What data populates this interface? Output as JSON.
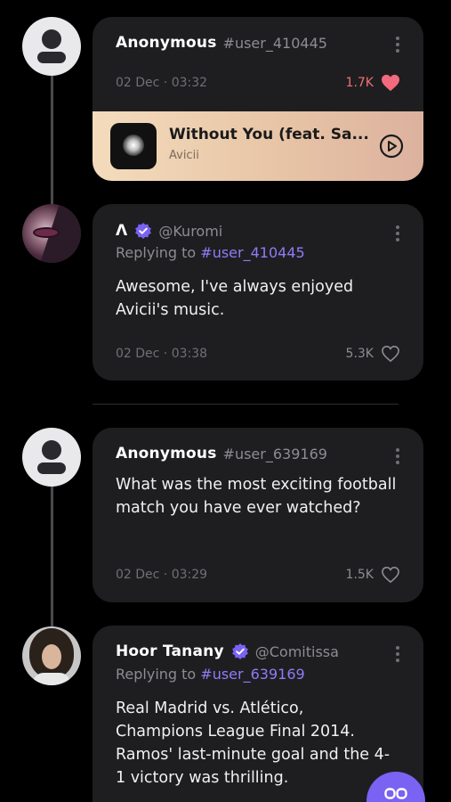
{
  "colors": {
    "background": "#000000",
    "card": "#1e1e21",
    "accent": "#8f7cf6",
    "fab": "#7a62f2",
    "like_hot": "#f07070",
    "music_gradient_start": "#f3dcbc",
    "music_gradient_end": "#dcb29f"
  },
  "posts": [
    {
      "author": "Anonymous",
      "handle": "#user_410445",
      "avatar_icon": "anonymous-user-icon",
      "date": "02 Dec · 03:32",
      "likes": "1.7K",
      "liked": true,
      "music": {
        "title": "Without You (feat. Sa...",
        "artist": "Avicii",
        "play_icon": "play-circle-icon"
      }
    },
    {
      "author": "Λ",
      "verified": true,
      "handle": "@Kuromi",
      "reply_prefix": "Replying to",
      "reply_to": "#user_410445",
      "text": "Awesome, I've always enjoyed Avicii's music.",
      "date": "02 Dec · 03:38",
      "likes": "5.3K",
      "liked": false
    },
    {
      "author": "Anonymous",
      "handle": "#user_639169",
      "avatar_icon": "anonymous-user-icon",
      "text": "What was the most exciting football match you have ever watched?",
      "date": "02 Dec · 03:29",
      "likes": "1.5K",
      "liked": false
    },
    {
      "author": "Hoor Tanany",
      "verified": true,
      "handle": "@Comitissa",
      "reply_prefix": "Replying to",
      "reply_to": "#user_639169",
      "text": "Real Madrid vs. Atlético, Champions League Final 2014. Ramos' last-minute goal and the 4-1 victory was thrilling."
    }
  ],
  "fab": {
    "icon": "infinity-icon"
  }
}
